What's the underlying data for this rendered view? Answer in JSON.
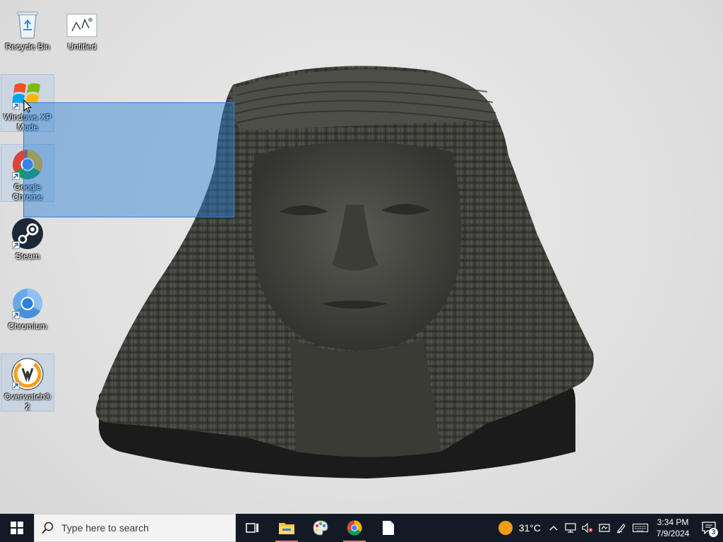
{
  "desktop": {
    "icons": [
      {
        "label": "Recycle Bin"
      },
      {
        "label": "Untitled"
      },
      {
        "label": "Windows XP Mode"
      },
      {
        "label": "Google Chrome"
      },
      {
        "label": "Steam"
      },
      {
        "label": "Chromium"
      },
      {
        "label": "Overwatch® 2"
      }
    ]
  },
  "taskbar": {
    "search_placeholder": "Type here to search",
    "pinned": [
      "task-view",
      "file-explorer",
      "paint",
      "google-chrome",
      "notepad"
    ],
    "weather": {
      "temp": "31°C",
      "icon": "sun-icon"
    },
    "tray_icons": [
      "chevron-up-icon",
      "network-icon",
      "volume-muted-icon",
      "meet-now-icon",
      "pen-icon",
      "keyboard-icon"
    ],
    "clock": {
      "time": "3:34 PM",
      "date": "7/9/2024"
    },
    "notifications": {
      "count": "3"
    }
  },
  "colors": {
    "taskbar": "#121a25",
    "selection": "#2f7fd8",
    "accent_underline": "#e97b74"
  }
}
